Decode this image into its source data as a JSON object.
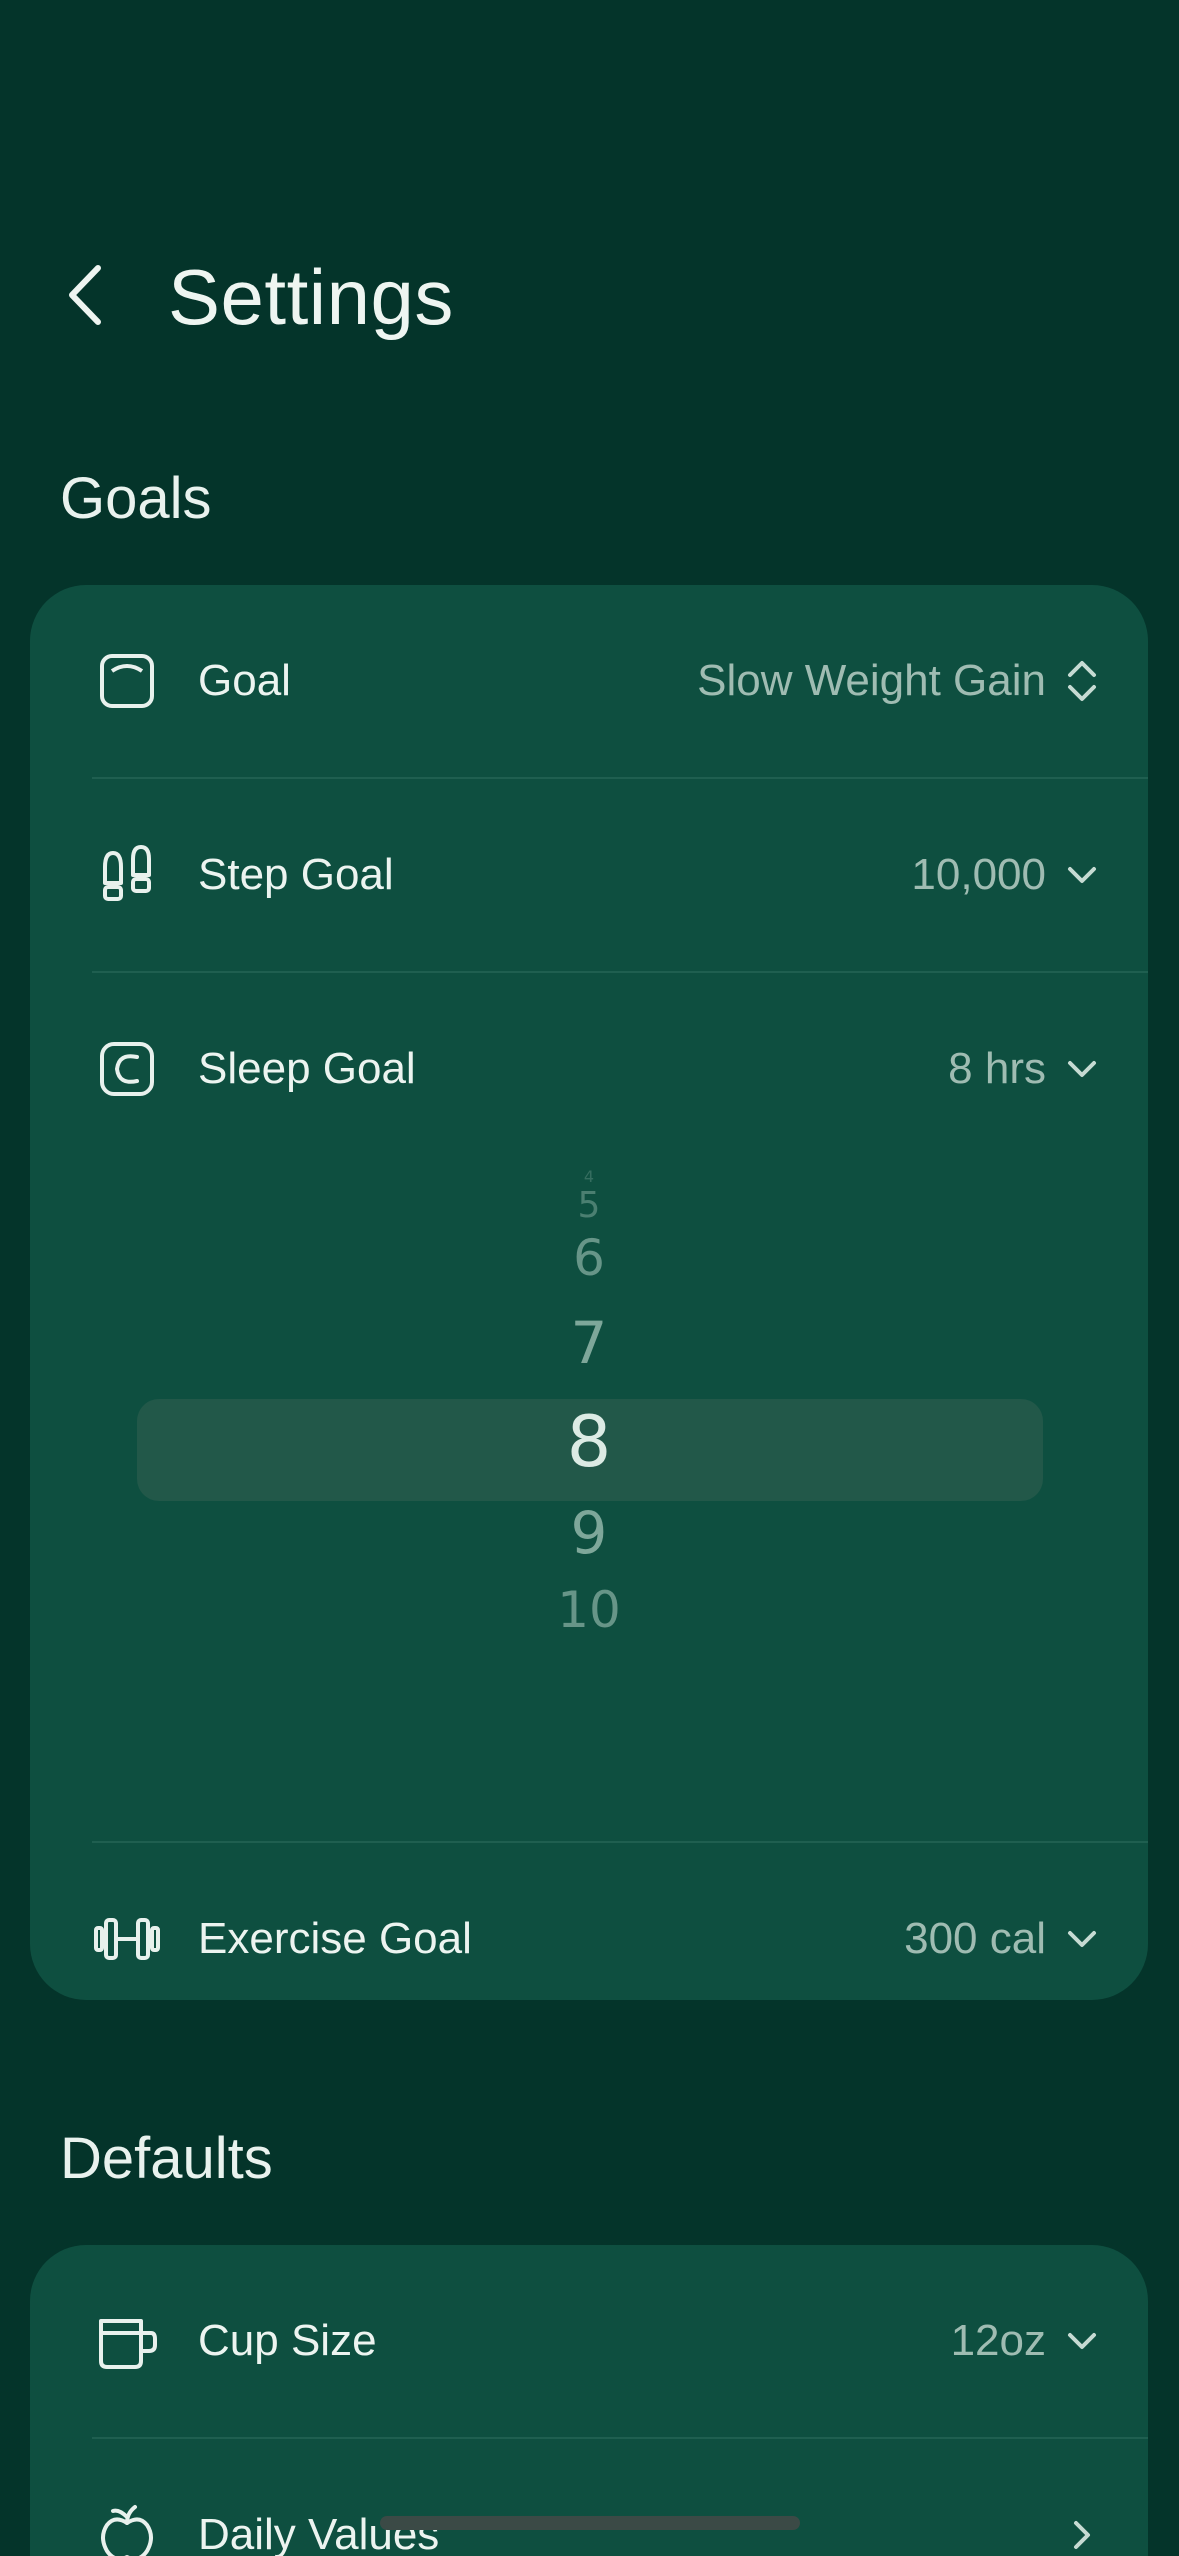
{
  "header": {
    "title": "Settings"
  },
  "goals": {
    "section_title": "Goals",
    "rows": [
      {
        "label": "Goal",
        "value": "Slow Weight Gain"
      },
      {
        "label": "Step Goal",
        "value": "10,000"
      },
      {
        "label": "Sleep Goal",
        "value": "8 hrs"
      },
      {
        "label": "Exercise Goal",
        "value": "300 cal"
      }
    ],
    "sleep_picker": {
      "options": [
        "4",
        "5",
        "6",
        "7",
        "8",
        "9",
        "10"
      ],
      "selected": "8"
    }
  },
  "defaults": {
    "section_title": "Defaults",
    "rows": [
      {
        "label": "Cup Size",
        "value": "12oz"
      },
      {
        "label": "Daily Values",
        "value": ""
      }
    ]
  },
  "colors": {
    "background": "#04342a",
    "card": "#0e4f40",
    "accent_text": "#9fbcb2"
  }
}
